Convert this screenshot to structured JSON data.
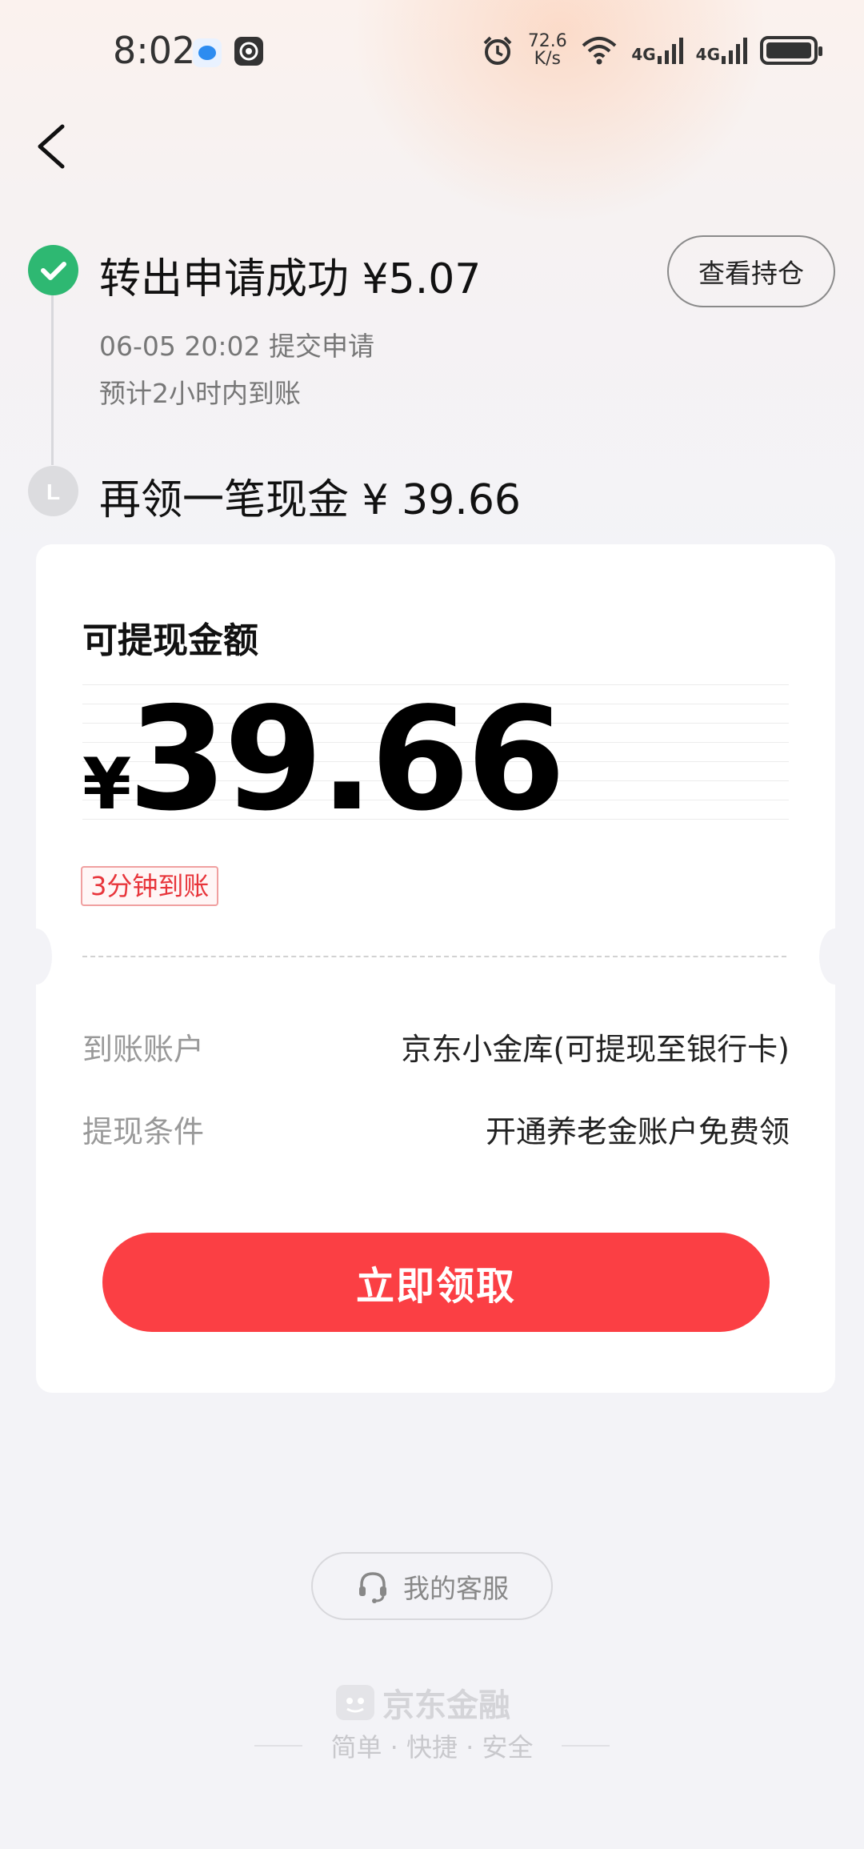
{
  "status_bar": {
    "time": "8:02",
    "net_speed_value": "72.6",
    "net_speed_unit": "K/s",
    "signal1": "4G",
    "signal2": "4G"
  },
  "nav": {
    "back_icon": "chevron-left-icon"
  },
  "timeline": {
    "step1_title": "转出申请成功 ¥5.07",
    "step1_time": "06-05 20:02 提交申请",
    "step1_eta": "预计2小时内到账",
    "step2_title": "再领一笔现金 ¥ 39.66",
    "step2_icon_letter": "L",
    "view_holdings": "查看持仓"
  },
  "card": {
    "label": "可提现金额",
    "currency": "¥",
    "amount": "39.66",
    "tag": "3分钟到账",
    "account_label": "到账账户",
    "account_value": "京东小金库(可提现至银行卡)",
    "condition_label": "提现条件",
    "condition_value": "开通养老金账户免费领",
    "claim_button": "立即领取"
  },
  "footer": {
    "service": "我的客服",
    "brand": "京东金融",
    "slogan": "简单 · 快捷 · 安全"
  },
  "colors": {
    "accent": "#fb3f44",
    "success": "#2eb872",
    "tag_text": "#e8353b"
  }
}
